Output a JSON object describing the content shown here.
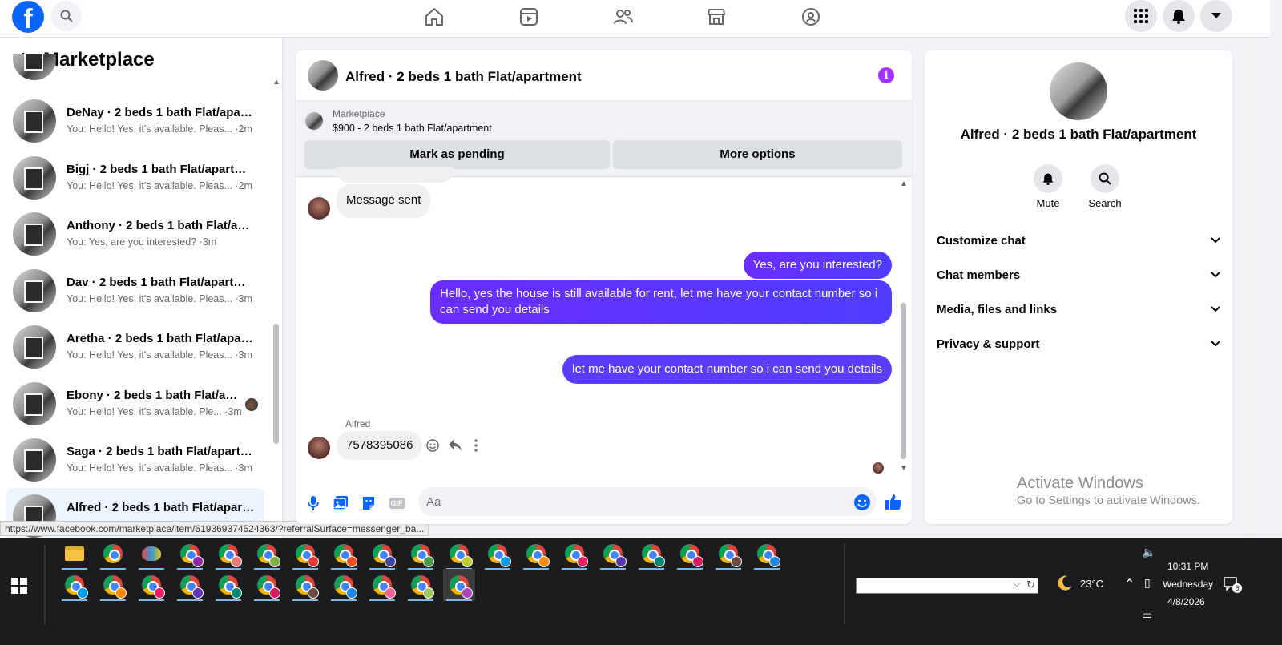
{
  "topbar": {
    "logo_letter": "f",
    "nav_icons": [
      "home-icon",
      "video-icon",
      "friends-icon",
      "marketplace-icon",
      "groups-icon"
    ],
    "right_icons": [
      "menu-grid-icon",
      "notifications-bell-icon",
      "account-chevron-icon"
    ]
  },
  "left": {
    "title": "Marketplace",
    "conversations": [
      {
        "name": "DeNay · 2 beds 1 bath Flat/apart...",
        "preview": "You: Hello! Yes, it's available. Pleas... ·2m"
      },
      {
        "name": "Bigj · 2 beds 1 bath Flat/apartme...",
        "preview": "You: Hello! Yes, it's available. Pleas... ·2m"
      },
      {
        "name": "Anthony · 2 beds 1 bath Flat/apa...",
        "preview": "You: Yes, are you interested? ·3m"
      },
      {
        "name": "Dav · 2 beds 1 bath Flat/apartme...",
        "preview": "You: Hello! Yes, it's available. Pleas... ·3m"
      },
      {
        "name": "Aretha · 2 beds 1 bath Flat/apart...",
        "preview": "You: Hello! Yes, it's available. Pleas... ·3m"
      },
      {
        "name": "Ebony · 2 beds 1 bath Flat/apa...",
        "preview": "You: Hello! Yes, it's available. Ple... ·3m"
      },
      {
        "name": "Saga · 2 beds 1 bath Flat/apartm...",
        "preview": "You: Hello! Yes, it's available. Pleas... ·3m"
      },
      {
        "name": "Alfred · 2 beds 1 bath Flat/apart...",
        "preview": ""
      }
    ]
  },
  "status_url": "https://www.facebook.com/marketplace/item/619369374524363/?referralSurface=messenger_ba...",
  "chat": {
    "title": "Alfred · 2 beds 1 bath Flat/apartment",
    "marketplace_label": "Marketplace",
    "listing": "$900 - 2 beds 1 bath Flat/apartment",
    "mark_pending": "Mark as pending",
    "more_options": "More options",
    "messages": {
      "m1": "Message sent",
      "m2": "Yes, are you interested?",
      "m3": "Hello, yes the house is still available for rent, let me have your contact number so i can send you details",
      "m4": "let me have your contact number so i can send you details",
      "sender": "Alfred",
      "m5": "7578395086"
    },
    "input_placeholder": "Aa"
  },
  "right": {
    "name": "Alfred · 2 beds 1 bath Flat/apartment",
    "mute": "Mute",
    "search": "Search",
    "sections": [
      "Customize chat",
      "Chat members",
      "Media, files and links",
      "Privacy & support"
    ],
    "activate_title": "Activate Windows",
    "activate_sub": "Go to Settings to activate Windows."
  },
  "taskbar": {
    "weather": "23°C",
    "time": "10:31 PM",
    "day": "Wednesday",
    "date": "4/8/2026",
    "notification_count": "6",
    "profile_badge_colors": [
      "#8e24aa",
      "#e67c73",
      "#7cb342",
      "#e53935",
      "#f4511e",
      "#3949ab",
      "#43a047",
      "#c0ca33",
      "#039be5",
      "#fb8c00",
      "#e91e63",
      "#5e35b1",
      "#00897b",
      "#d81b60",
      "#6d4c41",
      "#1e88e5",
      "#f06292",
      "#9ccc65",
      "#ab47bc",
      "#ef5350",
      "#26a69a",
      "#ffa726",
      "#7e57c2",
      "#66bb6a"
    ]
  }
}
